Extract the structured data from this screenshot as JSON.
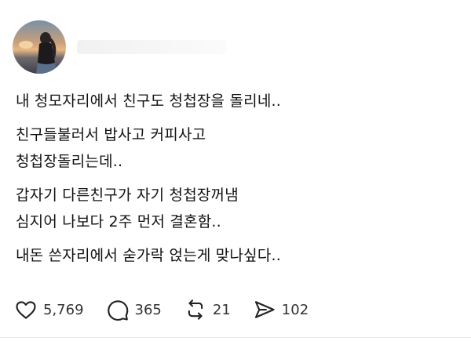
{
  "post": {
    "username": "",
    "lines": [
      [
        "내 청모자리에서 친구도 청첩장을 돌리네.."
      ],
      [
        "친구들불러서 밥사고 커피사고",
        "청첩장돌리는데.."
      ],
      [
        "갑자기 다른친구가 자기 청첩장꺼냄",
        "심지어 나보다 2주 먼저 결혼함.."
      ],
      [
        "내돈 쓴자리에서 숟가락 얹는게 맞나싶다.."
      ]
    ]
  },
  "actions": {
    "likes": "5,769",
    "comments": "365",
    "reposts": "21",
    "shares": "102"
  },
  "icons": [
    "heart-icon",
    "comment-icon",
    "repost-icon",
    "share-icon"
  ]
}
